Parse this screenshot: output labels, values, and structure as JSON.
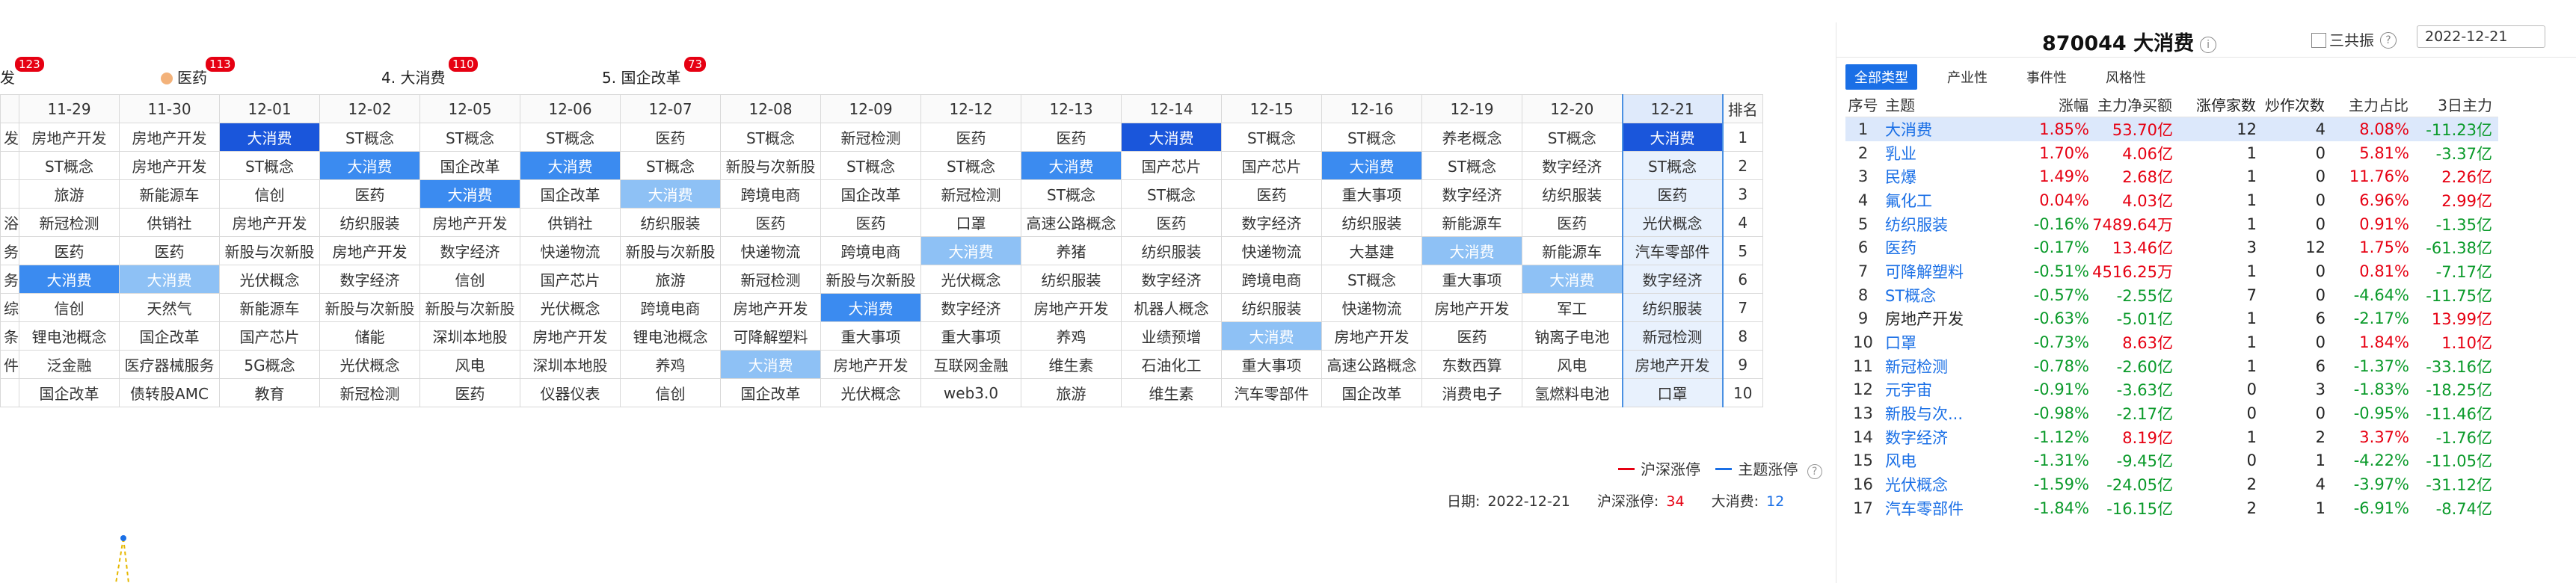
{
  "top_tags": [
    {
      "rank_label": "产开发",
      "badge": "123",
      "icon": ""
    },
    {
      "rank_label": "医药",
      "badge": "113",
      "icon": "orange-dot-icon"
    },
    {
      "rank_label": "4. 大消费",
      "badge": "110",
      "icon": ""
    },
    {
      "rank_label": "5. 国企改革",
      "badge": "73",
      "icon": ""
    }
  ],
  "grid": {
    "dates": [
      "11-29",
      "11-30",
      "12-01",
      "12-02",
      "12-05",
      "12-06",
      "12-07",
      "12-08",
      "12-09",
      "12-12",
      "12-13",
      "12-14",
      "12-15",
      "12-16",
      "12-19",
      "12-20",
      "12-21"
    ],
    "rank_header": "排名",
    "left_stub": [
      "发",
      "",
      "",
      "浴",
      "务",
      "务",
      "综",
      "条",
      "件"
    ],
    "rows": [
      [
        "房地产开发",
        "房地产开发",
        "大消费",
        "ST概念",
        "ST概念",
        "ST概念",
        "医药",
        "ST概念",
        "新冠检测",
        "医药",
        "医药",
        "大消费",
        "ST概念",
        "ST概念",
        "养老概念",
        "ST概念",
        "大消费"
      ],
      [
        "ST概念",
        "房地产开发",
        "ST概念",
        "大消费",
        "国企改革",
        "大消费",
        "ST概念",
        "新股与次新股",
        "ST概念",
        "ST概念",
        "大消费",
        "国产芯片",
        "国产芯片",
        "大消费",
        "ST概念",
        "数字经济",
        "ST概念"
      ],
      [
        "旅游",
        "新能源车",
        "信创",
        "医药",
        "大消费",
        "国企改革",
        "大消费",
        "跨境电商",
        "国企改革",
        "新冠检测",
        "ST概念",
        "ST概念",
        "医药",
        "重大事项",
        "数字经济",
        "纺织服装",
        "医药"
      ],
      [
        "新冠检测",
        "供销社",
        "房地产开发",
        "纺织服装",
        "房地产开发",
        "供销社",
        "纺织服装",
        "医药",
        "医药",
        "口罩",
        "高速公路概念",
        "医药",
        "数字经济",
        "纺织服装",
        "新能源车",
        "医药",
        "光伏概念"
      ],
      [
        "医药",
        "医药",
        "新股与次新股",
        "房地产开发",
        "数字经济",
        "快递物流",
        "新股与次新股",
        "快递物流",
        "跨境电商",
        "大消费",
        "养猪",
        "纺织服装",
        "快递物流",
        "大基建",
        "大消费",
        "新能源车",
        "汽车零部件"
      ],
      [
        "大消费",
        "大消费",
        "光伏概念",
        "数字经济",
        "信创",
        "国产芯片",
        "旅游",
        "新冠检测",
        "新股与次新股",
        "光伏概念",
        "纺织服装",
        "数字经济",
        "跨境电商",
        "ST概念",
        "重大事项",
        "大消费",
        "数字经济"
      ],
      [
        "信创",
        "天然气",
        "新能源车",
        "新股与次新股",
        "新股与次新股",
        "光伏概念",
        "跨境电商",
        "房地产开发",
        "大消费",
        "数字经济",
        "房地产开发",
        "机器人概念",
        "纺织服装",
        "快递物流",
        "房地产开发",
        "军工",
        "纺织服装"
      ],
      [
        "锂电池概念",
        "国企改革",
        "国产芯片",
        "储能",
        "深圳本地股",
        "房地产开发",
        "锂电池概念",
        "可降解塑料",
        "重大事项",
        "重大事项",
        "养鸡",
        "业绩预增",
        "大消费",
        "房地产开发",
        "医药",
        "钠离子电池",
        "新冠检测"
      ],
      [
        "泛金融",
        "医疗器械服务",
        "5G概念",
        "光伏概念",
        "风电",
        "深圳本地股",
        "养鸡",
        "大消费",
        "房地产开发",
        "互联网金融",
        "维生素",
        "石油化工",
        "重大事项",
        "高速公路概念",
        "东数西算",
        "风电",
        "房地产开发"
      ],
      [
        "国企改革",
        "债转股AMC",
        "教育",
        "新冠检测",
        "医药",
        "仪器仪表",
        "信创",
        "国企改革",
        "光伏概念",
        "web3.0",
        "旅游",
        "维生素",
        "汽车零部件",
        "国企改革",
        "消费电子",
        "氢燃料电池",
        "口罩"
      ]
    ],
    "highlights": [
      [
        -1,
        -1,
        1,
        -1,
        -1,
        -1,
        -1,
        -1,
        -1,
        -1,
        -1,
        1,
        -1,
        -1,
        -1,
        -1,
        2
      ],
      [
        -1,
        -1,
        -1,
        2,
        -1,
        2,
        -1,
        -1,
        -1,
        -1,
        2,
        -1,
        -1,
        2,
        -1,
        -1,
        -1
      ],
      [
        -1,
        -1,
        -1,
        -1,
        2,
        -1,
        3,
        -1,
        -1,
        -1,
        -1,
        -1,
        -1,
        -1,
        -1,
        -1,
        -1
      ],
      [
        -1,
        -1,
        -1,
        -1,
        -1,
        -1,
        -1,
        -1,
        -1,
        -1,
        -1,
        -1,
        -1,
        -1,
        -1,
        -1,
        -1
      ],
      [
        -1,
        -1,
        -1,
        -1,
        -1,
        -1,
        -1,
        -1,
        -1,
        3,
        -1,
        -1,
        -1,
        -1,
        3,
        -1,
        -1
      ],
      [
        2,
        3,
        -1,
        -1,
        -1,
        -1,
        -1,
        -1,
        -1,
        -1,
        -1,
        -1,
        -1,
        -1,
        -1,
        3,
        -1
      ],
      [
        -1,
        -1,
        -1,
        -1,
        -1,
        -1,
        -1,
        -1,
        2,
        -1,
        -1,
        -1,
        -1,
        -1,
        -1,
        -1,
        -1
      ],
      [
        -1,
        -1,
        -1,
        -1,
        -1,
        -1,
        -1,
        -1,
        -1,
        -1,
        -1,
        -1,
        3,
        -1,
        -1,
        -1,
        -1
      ],
      [
        -1,
        -1,
        -1,
        -1,
        -1,
        -1,
        -1,
        3,
        -1,
        -1,
        -1,
        -1,
        -1,
        -1,
        -1,
        -1,
        -1
      ],
      [
        -1,
        -1,
        -1,
        -1,
        -1,
        -1,
        -1,
        -1,
        -1,
        -1,
        -1,
        -1,
        -1,
        -1,
        -1,
        -1,
        -1
      ]
    ],
    "selected_column": "12-21"
  },
  "legend": {
    "red_label": "沪深涨停",
    "blue_label": "主题涨停",
    "red_color": "#e60012",
    "blue_color": "#1a6fe6"
  },
  "footer": {
    "date_label": "日期:",
    "date": "2022-12-21",
    "limit_label": "沪深涨停:",
    "limit_value": "34",
    "theme_label": "大消费:",
    "theme_value": "12"
  },
  "panel": {
    "title": "870044 大消费",
    "checkbox_label": "三共振",
    "date_value": "2022-12-21",
    "tabs": [
      "全部类型",
      "产业性",
      "事件性",
      "风格性"
    ],
    "active_tab": 0,
    "headers": [
      "序号",
      "主题",
      "涨幅",
      "主力净买额",
      "涨停家数",
      "炒作次数",
      "主力占比",
      "3日主力"
    ],
    "rows": [
      [
        "1",
        "大消费",
        "1.85%",
        "53.70亿",
        "12",
        "4",
        "8.08%",
        "-11.23亿"
      ],
      [
        "2",
        "乳业",
        "1.70%",
        "4.06亿",
        "1",
        "0",
        "5.81%",
        "-3.37亿"
      ],
      [
        "3",
        "民爆",
        "1.49%",
        "2.68亿",
        "1",
        "0",
        "11.76%",
        "2.26亿"
      ],
      [
        "4",
        "氟化工",
        "0.04%",
        "4.03亿",
        "1",
        "0",
        "6.96%",
        "2.99亿"
      ],
      [
        "5",
        "纺织服装",
        "-0.16%",
        "7489.64万",
        "1",
        "0",
        "0.91%",
        "-1.35亿"
      ],
      [
        "6",
        "医药",
        "-0.17%",
        "13.46亿",
        "3",
        "12",
        "1.75%",
        "-61.38亿"
      ],
      [
        "7",
        "可降解塑料",
        "-0.51%",
        "4516.25万",
        "1",
        "0",
        "0.81%",
        "-7.17亿"
      ],
      [
        "8",
        "ST概念",
        "-0.57%",
        "-2.55亿",
        "7",
        "0",
        "-4.64%",
        "-11.75亿"
      ],
      [
        "9",
        "房地产开发",
        "-0.63%",
        "-5.01亿",
        "1",
        "6",
        "-2.17%",
        "13.99亿"
      ],
      [
        "10",
        "口罩",
        "-0.73%",
        "8.63亿",
        "1",
        "0",
        "1.84%",
        "1.10亿"
      ],
      [
        "11",
        "新冠检测",
        "-0.78%",
        "-2.60亿",
        "1",
        "6",
        "-1.37%",
        "-33.16亿"
      ],
      [
        "12",
        "元宇宙",
        "-0.91%",
        "-3.63亿",
        "0",
        "3",
        "-1.83%",
        "-18.25亿"
      ],
      [
        "13",
        "新股与次...",
        "-0.98%",
        "-2.17亿",
        "0",
        "0",
        "-0.95%",
        "-11.46亿"
      ],
      [
        "14",
        "数字经济",
        "-1.12%",
        "8.19亿",
        "1",
        "2",
        "3.37%",
        "-1.76亿"
      ],
      [
        "15",
        "风电",
        "-1.31%",
        "-9.45亿",
        "0",
        "1",
        "-4.22%",
        "-11.05亿"
      ],
      [
        "16",
        "光伏概念",
        "-1.59%",
        "-24.05亿",
        "2",
        "4",
        "-3.97%",
        "-31.12亿"
      ],
      [
        "17",
        "汽车零部件",
        "-1.84%",
        "-16.15亿",
        "2",
        "1",
        "-6.91%",
        "-8.74亿"
      ]
    ]
  }
}
